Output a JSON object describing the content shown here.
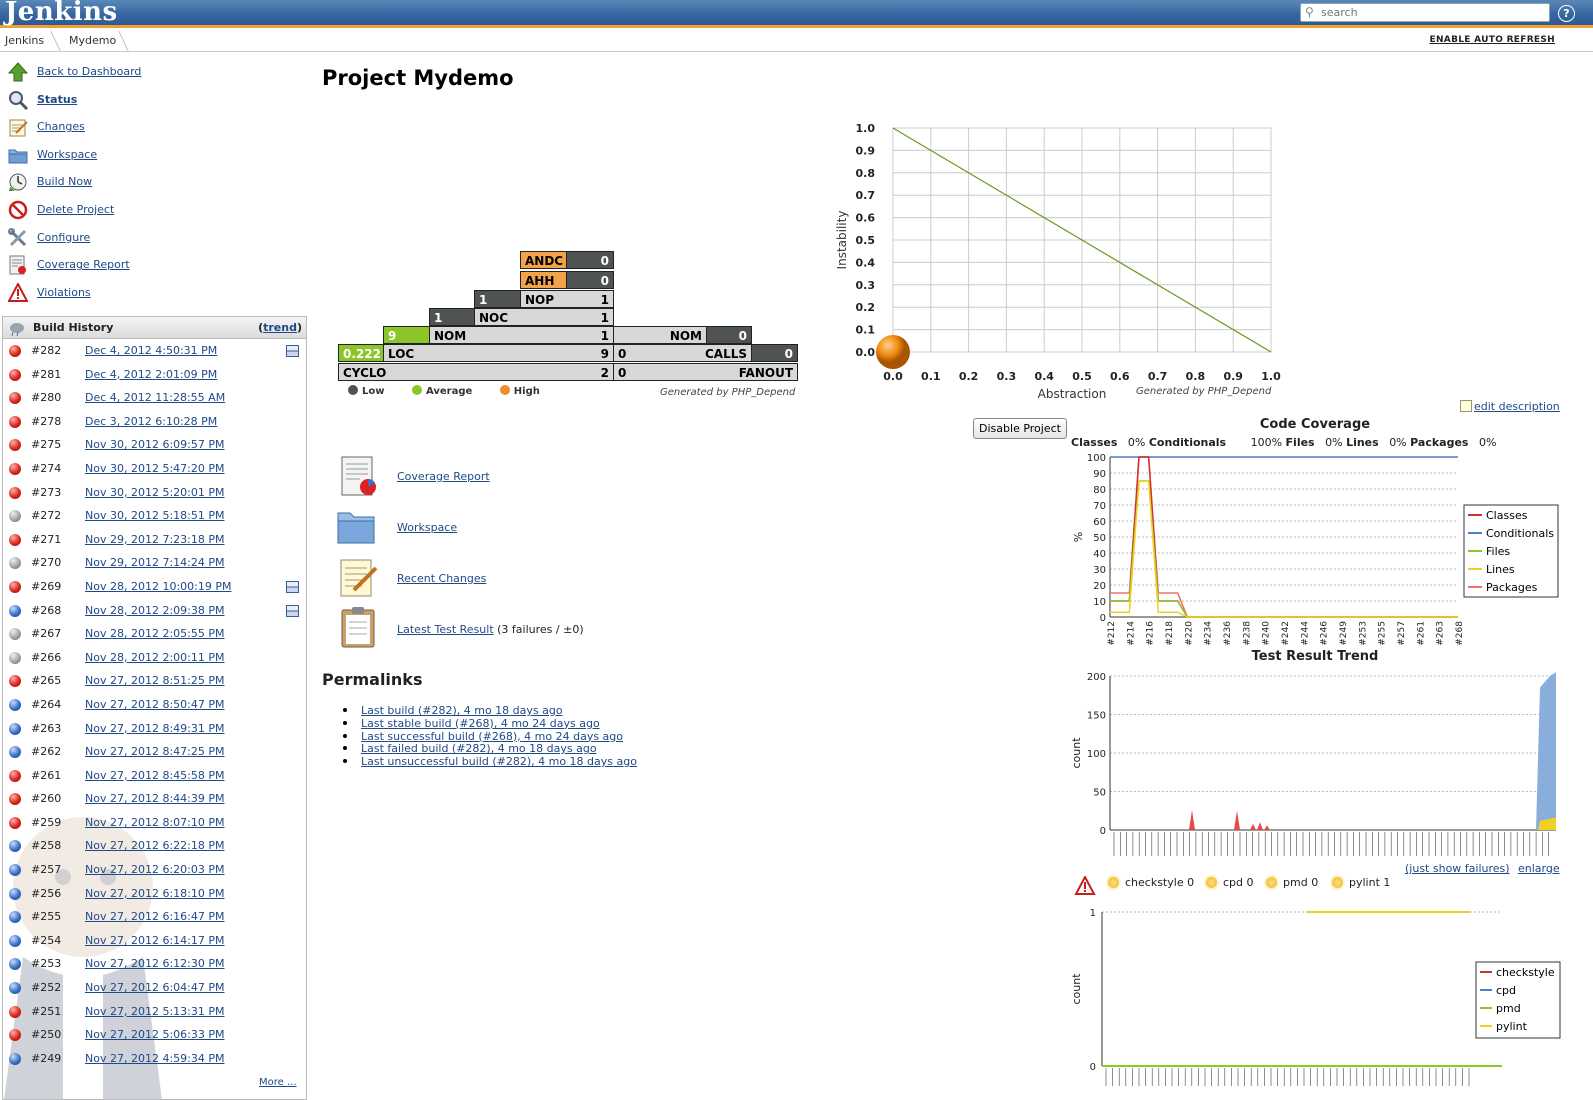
{
  "header": {
    "logo": "Jenkins",
    "search_placeholder": "search",
    "help": "?"
  },
  "breadcrumb": {
    "items": [
      "Jenkins",
      "Mydemo"
    ],
    "auto_refresh": "ENABLE AUTO REFRESH"
  },
  "tasks": [
    {
      "label": "Back to Dashboard",
      "icon": "up-arrow-icon"
    },
    {
      "label": "Status",
      "icon": "magnifier-icon"
    },
    {
      "label": "Changes",
      "icon": "notepad-icon"
    },
    {
      "label": "Workspace",
      "icon": "folder-icon"
    },
    {
      "label": "Build Now",
      "icon": "clock-icon"
    },
    {
      "label": "Delete Project",
      "icon": "no-entry-icon"
    },
    {
      "label": "Configure",
      "icon": "wrench-icon"
    },
    {
      "label": "Coverage Report",
      "icon": "report-icon"
    },
    {
      "label": "Violations",
      "icon": "warning-icon"
    }
  ],
  "build_history": {
    "title": "Build History",
    "trend_open": "(",
    "trend": "trend",
    "trend_close": ")",
    "more": "More ...",
    "builds": [
      {
        "num": "#282",
        "date": "Dec 4, 2012 4:50:31 PM",
        "status": "red",
        "kept": true
      },
      {
        "num": "#281",
        "date": "Dec 4, 2012 2:01:09 PM",
        "status": "red",
        "kept": false
      },
      {
        "num": "#280",
        "date": "Dec 4, 2012 11:28:55 AM",
        "status": "red",
        "kept": false
      },
      {
        "num": "#278",
        "date": "Dec 3, 2012 6:10:28 PM",
        "status": "red",
        "kept": false
      },
      {
        "num": "#275",
        "date": "Nov 30, 2012 6:09:57 PM",
        "status": "red",
        "kept": false
      },
      {
        "num": "#274",
        "date": "Nov 30, 2012 5:47:20 PM",
        "status": "red",
        "kept": false
      },
      {
        "num": "#273",
        "date": "Nov 30, 2012 5:20:01 PM",
        "status": "red",
        "kept": false
      },
      {
        "num": "#272",
        "date": "Nov 30, 2012 5:18:51 PM",
        "status": "grey",
        "kept": false
      },
      {
        "num": "#271",
        "date": "Nov 29, 2012 7:23:18 PM",
        "status": "red",
        "kept": false
      },
      {
        "num": "#270",
        "date": "Nov 29, 2012 7:14:24 PM",
        "status": "grey",
        "kept": false
      },
      {
        "num": "#269",
        "date": "Nov 28, 2012 10:00:19 PM",
        "status": "red",
        "kept": true
      },
      {
        "num": "#268",
        "date": "Nov 28, 2012 2:09:38 PM",
        "status": "blue",
        "kept": true
      },
      {
        "num": "#267",
        "date": "Nov 28, 2012 2:05:55 PM",
        "status": "grey",
        "kept": false
      },
      {
        "num": "#266",
        "date": "Nov 28, 2012 2:00:11 PM",
        "status": "grey",
        "kept": false
      },
      {
        "num": "#265",
        "date": "Nov 27, 2012 8:51:25 PM",
        "status": "red",
        "kept": false
      },
      {
        "num": "#264",
        "date": "Nov 27, 2012 8:50:47 PM",
        "status": "blue",
        "kept": false
      },
      {
        "num": "#263",
        "date": "Nov 27, 2012 8:49:31 PM",
        "status": "blue",
        "kept": false
      },
      {
        "num": "#262",
        "date": "Nov 27, 2012 8:47:25 PM",
        "status": "blue",
        "kept": false
      },
      {
        "num": "#261",
        "date": "Nov 27, 2012 8:45:58 PM",
        "status": "red",
        "kept": false
      },
      {
        "num": "#260",
        "date": "Nov 27, 2012 8:44:39 PM",
        "status": "red",
        "kept": false
      },
      {
        "num": "#259",
        "date": "Nov 27, 2012 8:07:10 PM",
        "status": "red",
        "kept": false
      },
      {
        "num": "#258",
        "date": "Nov 27, 2012 6:22:18 PM",
        "status": "blue",
        "kept": false
      },
      {
        "num": "#257",
        "date": "Nov 27, 2012 6:20:03 PM",
        "status": "blue",
        "kept": false
      },
      {
        "num": "#256",
        "date": "Nov 27, 2012 6:18:10 PM",
        "status": "blue",
        "kept": false
      },
      {
        "num": "#255",
        "date": "Nov 27, 2012 6:16:47 PM",
        "status": "blue",
        "kept": false
      },
      {
        "num": "#254",
        "date": "Nov 27, 2012 6:14:17 PM",
        "status": "blue",
        "kept": false
      },
      {
        "num": "#253",
        "date": "Nov 27, 2012 6:12:30 PM",
        "status": "blue",
        "kept": false
      },
      {
        "num": "#252",
        "date": "Nov 27, 2012 6:04:47 PM",
        "status": "blue",
        "kept": false
      },
      {
        "num": "#251",
        "date": "Nov 27, 2012 5:13:31 PM",
        "status": "red",
        "kept": false
      },
      {
        "num": "#250",
        "date": "Nov 27, 2012 5:06:33 PM",
        "status": "red",
        "kept": false
      },
      {
        "num": "#249",
        "date": "Nov 27, 2012 4:59:34 PM",
        "status": "blue",
        "kept": false
      }
    ]
  },
  "main": {
    "title": "Project Mydemo",
    "edit_description": "edit description",
    "disable_button": "Disable Project",
    "actions": [
      {
        "label": "Coverage Report",
        "suffix": "",
        "icon": "coverage-report-icon"
      },
      {
        "label": "Workspace",
        "suffix": "",
        "icon": "workspace-folder-icon"
      },
      {
        "label": "Recent Changes",
        "suffix": "",
        "icon": "recent-changes-icon"
      },
      {
        "label": "Latest Test Result",
        "suffix": " (3 failures / ±0)",
        "icon": "clipboard-icon"
      }
    ],
    "permalinks_title": "Permalinks",
    "permalinks": [
      "Last build (#282), 4 mo 18 days ago",
      "Last stable build (#268), 4 mo 24 days ago",
      "Last successful build (#268), 4 mo 24 days ago",
      "Last failed build (#282), 4 mo 18 days ago",
      "Last unsuccessful build (#282), 4 mo 18 days ago"
    ]
  },
  "pyramid": {
    "generated_by": "Generated by PHP_Depend",
    "colors": {
      "low": "#505450",
      "average": "#8cc528",
      "high": "#f2a34a"
    },
    "legend": [
      "Low",
      "Average",
      "High"
    ],
    "rows": {
      "andc": {
        "label": "ANDC",
        "value": "0"
      },
      "ahh": {
        "label": "AHH",
        "value": "0"
      },
      "nop": {
        "label": "NOP",
        "left": "1",
        "value": "1"
      },
      "noc": {
        "label": "NOC",
        "left": "1",
        "value": "1"
      },
      "nom": {
        "label": "NOM",
        "left": "9",
        "value": "1"
      },
      "loc": {
        "label": "LOC",
        "left": "0.222",
        "value": "9"
      },
      "cyclo": {
        "label": "CYCLO",
        "value": "2"
      },
      "nom_right": {
        "label": "NOM",
        "value": "0"
      },
      "calls": {
        "label": "CALLS",
        "left": "0",
        "value": "0"
      },
      "fanout": {
        "label": "FANOUT",
        "left": "0"
      }
    }
  },
  "charts": {
    "instability": {
      "generated_by": "Generated by PHP_Depend",
      "xlabel": "Abstraction",
      "ylabel": "Instability",
      "ticks": [
        "0.0",
        "0.1",
        "0.2",
        "0.3",
        "0.4",
        "0.5",
        "0.6",
        "0.7",
        "0.8",
        "0.9",
        "1.0"
      ],
      "main_sequence_color": "#6a9a1e",
      "point": {
        "abstraction": 0.0,
        "instability": 0.0,
        "color": "#f08c10"
      }
    },
    "coverage": {
      "title": "Code Coverage",
      "summary": [
        {
          "name": "Classes",
          "value": "0%"
        },
        {
          "name": "Conditionals",
          "value": "100%"
        },
        {
          "name": "Files",
          "value": "0%"
        },
        {
          "name": "Lines",
          "value": "0%"
        },
        {
          "name": "Packages",
          "value": "0%"
        }
      ],
      "ylabel": "%",
      "yticks": [
        "0",
        "10",
        "20",
        "30",
        "40",
        "50",
        "60",
        "70",
        "80",
        "90",
        "100"
      ],
      "xticks": [
        "#212",
        "#214",
        "#216",
        "#218",
        "#220",
        "#234",
        "#236",
        "#238",
        "#240",
        "#242",
        "#244",
        "#246",
        "#249",
        "#253",
        "#255",
        "#257",
        "#261",
        "#263",
        "#268"
      ],
      "series": [
        {
          "name": "Classes",
          "color": "#d03030"
        },
        {
          "name": "Conditionals",
          "color": "#4a7ec8"
        },
        {
          "name": "Files",
          "color": "#8cc828"
        },
        {
          "name": "Lines",
          "color": "#f0d020"
        },
        {
          "name": "Packages",
          "color": "#f07070"
        }
      ]
    },
    "test_trend": {
      "title": "Test Result Trend",
      "ylabel": "count",
      "yticks": [
        "0",
        "50",
        "100",
        "150",
        "200"
      ],
      "just_failures": "(just show failures)",
      "enlarge": "enlarge"
    },
    "violations": {
      "items": [
        {
          "name": "checkstyle",
          "count": "0"
        },
        {
          "name": "cpd",
          "count": "0"
        },
        {
          "name": "pmd",
          "count": "0"
        },
        {
          "name": "pylint",
          "count": "1"
        }
      ],
      "ylabel": "count",
      "yticks": [
        "0",
        "1"
      ],
      "legend": [
        {
          "name": "checkstyle",
          "color": "#d03030"
        },
        {
          "name": "cpd",
          "color": "#4a7ec8"
        },
        {
          "name": "pmd",
          "color": "#8cc828"
        },
        {
          "name": "pylint",
          "color": "#f0d020"
        }
      ]
    }
  }
}
